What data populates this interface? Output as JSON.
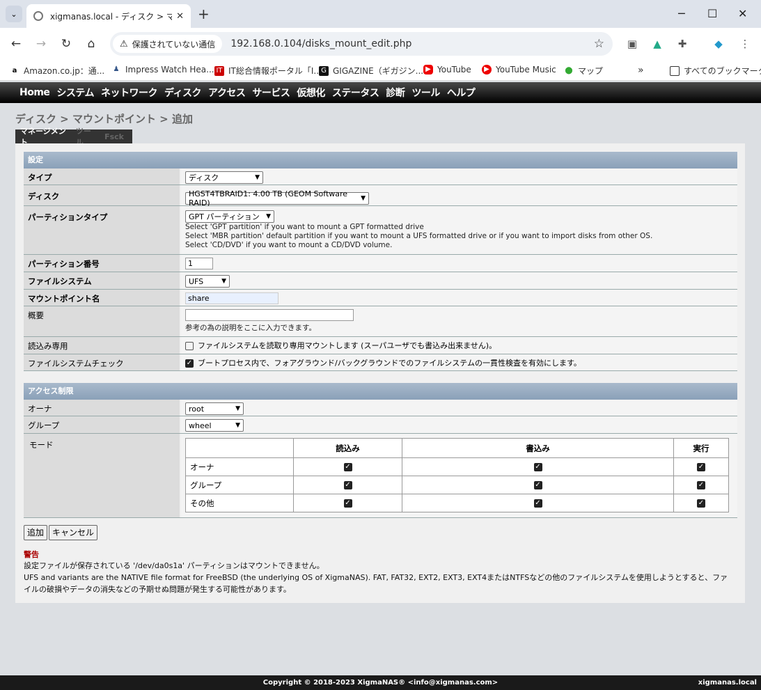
{
  "browser": {
    "tab_title": "xigmanas.local - ディスク > マウン",
    "security_label": "保護されていない通信",
    "url": "192.168.0.104/disks_mount_edit.php",
    "bookmarks": [
      "Amazon.co.jp：通...",
      "Impress Watch Hea...",
      "IT総合情報ポータル「I...",
      "GIGAZINE（ギガジン...",
      "YouTube",
      "YouTube Music",
      "マップ"
    ],
    "all_bookmarks": "すべてのブックマーク"
  },
  "nav": [
    "Home",
    "システム",
    "ネットワーク",
    "ディスク",
    "アクセス",
    "サービス",
    "仮想化",
    "ステータス",
    "診断",
    "ツール",
    "ヘルプ"
  ],
  "breadcrumb": "ディスク > マウントポイント > 追加",
  "subtabs": [
    "マネージメント",
    "ツール",
    "Fsck"
  ],
  "settings": {
    "header": "設定",
    "type_label": "タイプ",
    "type_value": "ディスク",
    "disk_label": "ディスク",
    "disk_value": "HGST4TBRAID1: 4.00 TB (GEOM Software RAID)",
    "ptype_label": "パーティションタイプ",
    "ptype_value": "GPT パーティション",
    "ptype_hint1": "Select 'GPT partition' if you want to mount a GPT formatted drive",
    "ptype_hint2": "Select 'MBR partition' default partition if you want to mount a UFS formatted drive or if you want to import disks from other OS.",
    "ptype_hint3": "Select 'CD/DVD' if you want to mount a CD/DVD volume.",
    "pnum_label": "パーティション番号",
    "pnum_value": "1",
    "fs_label": "ファイルシステム",
    "fs_value": "UFS",
    "mp_label": "マウントポイント名",
    "mp_value": "share",
    "desc_label": "概要",
    "desc_value": "",
    "desc_hint": "参考の為の説明をここに入力できます。",
    "ro_label": "読込み専用",
    "ro_text": "ファイルシステムを読取り専用マウントします (スーパユーザでも書込み出来ません)。",
    "fsck_label": "ファイルシステムチェック",
    "fsck_text": "ブートプロセス内で、フォアグラウンド/バックグラウンドでのファイルシステムの一貫性検査を有効にします。"
  },
  "access": {
    "header": "アクセス制限",
    "owner_label": "オーナ",
    "owner_value": "root",
    "group_label": "グループ",
    "group_value": "wheel",
    "mode_label": "モード",
    "cols": [
      "読込み",
      "書込み",
      "実行"
    ],
    "rows": [
      "オーナ",
      "グループ",
      "その他"
    ]
  },
  "buttons": {
    "add": "追加",
    "cancel": "キャンセル"
  },
  "warning": {
    "title": "警告",
    "line1": "設定ファイルが保存されている '/dev/da0s1a' パーティションはマウントできません。",
    "line2": "UFS and variants are the NATIVE file format for FreeBSD (the underlying OS of XigmaNAS). FAT, FAT32, EXT2, EXT3, EXT4またはNTFSなどの他のファイルシステムを使用しようとすると、ファイルの破損やデータの消失などの予期せぬ問題が発生する可能性があります。"
  },
  "footer": {
    "copyright": "Copyright © 2018-2023 XigmaNAS® <info@xigmanas.com>",
    "host": "xigmanas.local"
  }
}
